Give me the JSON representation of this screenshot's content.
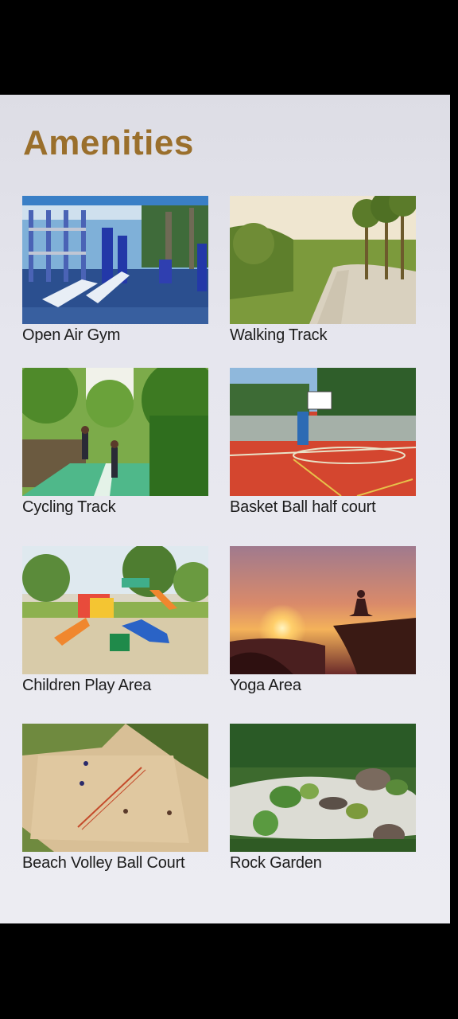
{
  "page": {
    "title": "Amenities",
    "title_color": "#9a6f2c",
    "background": "#e6e6ee"
  },
  "amenities": [
    {
      "label": "Open Air Gym",
      "image": "outdoor-gym-photo"
    },
    {
      "label": "Walking Track",
      "image": "walking-track-photo"
    },
    {
      "label": "Cycling Track",
      "image": "cycling-track-photo"
    },
    {
      "label": "Basket Ball half court",
      "image": "basketball-court-photo"
    },
    {
      "label": "Children Play Area",
      "image": "playground-photo"
    },
    {
      "label": "Yoga Area",
      "image": "yoga-sunset-photo"
    },
    {
      "label": "Beach Volley Ball Court",
      "image": "beach-volleyball-photo"
    },
    {
      "label": "Rock Garden",
      "image": "rock-garden-photo"
    }
  ]
}
